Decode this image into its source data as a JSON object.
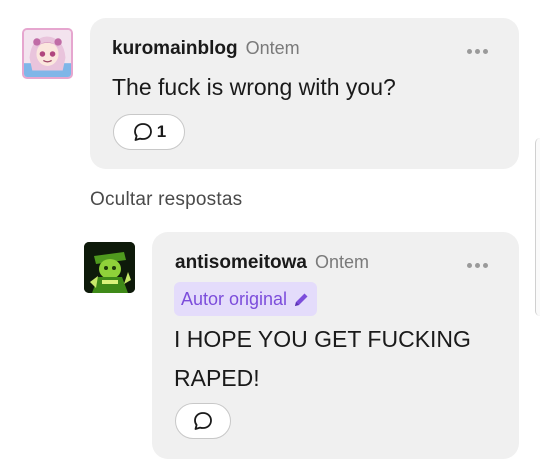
{
  "comments": [
    {
      "username": "kuromainblog",
      "timestamp": "Ontem",
      "text": "The fuck is wrong with you?",
      "reply_count": "1",
      "avatar_icon": "anime-girl-avatar"
    }
  ],
  "thread": {
    "hide_replies_label": "Ocultar respostas"
  },
  "replies": [
    {
      "username": "antisomeitowa",
      "timestamp": "Ontem",
      "badge_label": "Autor original",
      "text_line1": "I HOPE YOU GET FUCKING",
      "text_line2": "RAPED!",
      "avatar_icon": "green-character-avatar"
    }
  ],
  "colors": {
    "bubble_bg": "#f0f0f0",
    "badge_bg": "#e4dcfb",
    "badge_text": "#7c4ddb",
    "timestamp": "#7a7a7a"
  },
  "icons": {
    "more": "more-horizontal-icon",
    "reply": "speech-bubble-icon",
    "edit": "pencil-icon"
  }
}
